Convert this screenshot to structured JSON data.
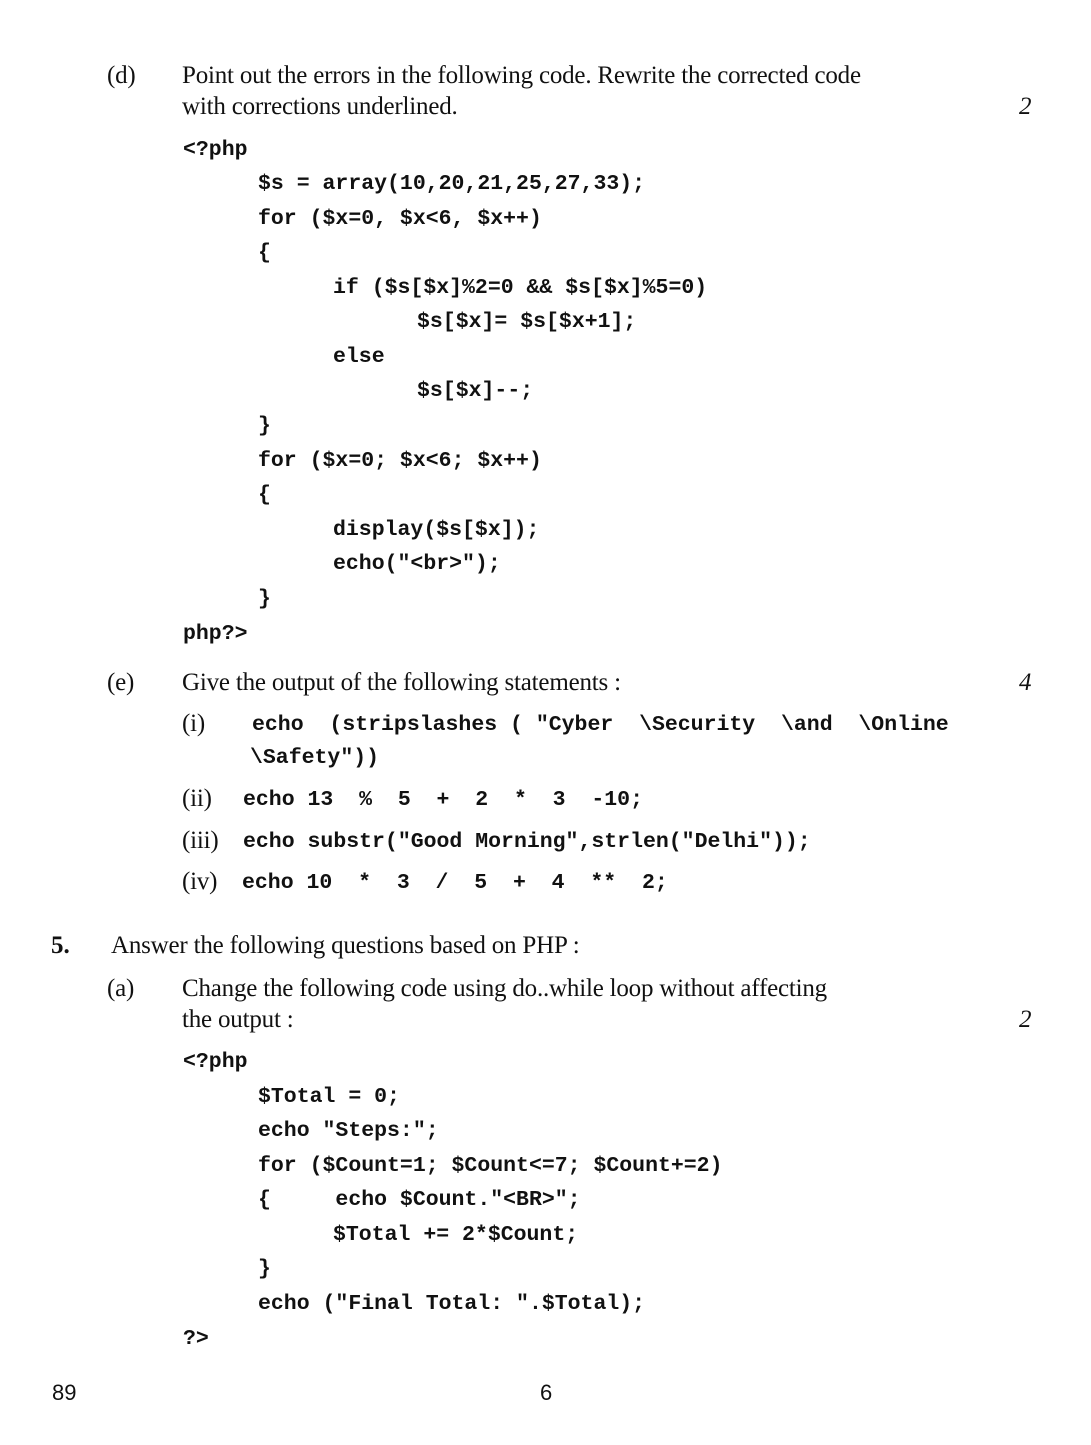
{
  "part_d": {
    "label": "(d)",
    "line1": "Point out the errors in the following code. Rewrite the corrected code",
    "line2": "with corrections underlined.",
    "marks": "2",
    "code": [
      "<?php",
      "$s = array(10,20,21,25,27,33);",
      "for ($x=0, $x<6, $x++)",
      "{",
      "if ($s[$x]%2=0 && $s[$x]%5=0)",
      "$s[$x]= $s[$x+1];",
      "else",
      "$s[$x]--;",
      "}",
      "for ($x=0; $x<6; $x++)",
      "{",
      "display($s[$x]);",
      "echo(\"<br>\");",
      "}",
      "php?>"
    ]
  },
  "part_e": {
    "label": "(e)",
    "text": "Give the output of the following statements :",
    "marks": "4",
    "items": [
      {
        "label": "(i)",
        "line1": "echo  (stripslashes ( \"Cyber  \\Security  \\and  \\Online",
        "line2": "\\Safety\"))"
      },
      {
        "label": "(ii)",
        "line1": "echo 13  %  5  +  2  *  3  -10;"
      },
      {
        "label": "(iii)",
        "line1": "echo substr(\"Good Morning\",strlen(\"Delhi\"));"
      },
      {
        "label": "(iv)",
        "line1": "echo 10  *  3  /  5  +  4  **  2;"
      }
    ]
  },
  "question_5": {
    "number": "5.",
    "text": "Answer the following questions based on PHP :",
    "part_a": {
      "label": "(a)",
      "line1": "Change the following code using do..while loop without affecting",
      "line2": "the output :",
      "marks": "2",
      "code": [
        "<?php",
        "$Total = 0;",
        "echo \"Steps:\";",
        "for ($Count=1; $Count<=7; $Count+=2)",
        "{     echo $Count.\"<BR>\";",
        "$Total += 2*$Count;",
        "}",
        "echo (\"Final Total: \".$Total);",
        "?>"
      ]
    }
  },
  "footer": {
    "code": "89",
    "page": "6"
  }
}
